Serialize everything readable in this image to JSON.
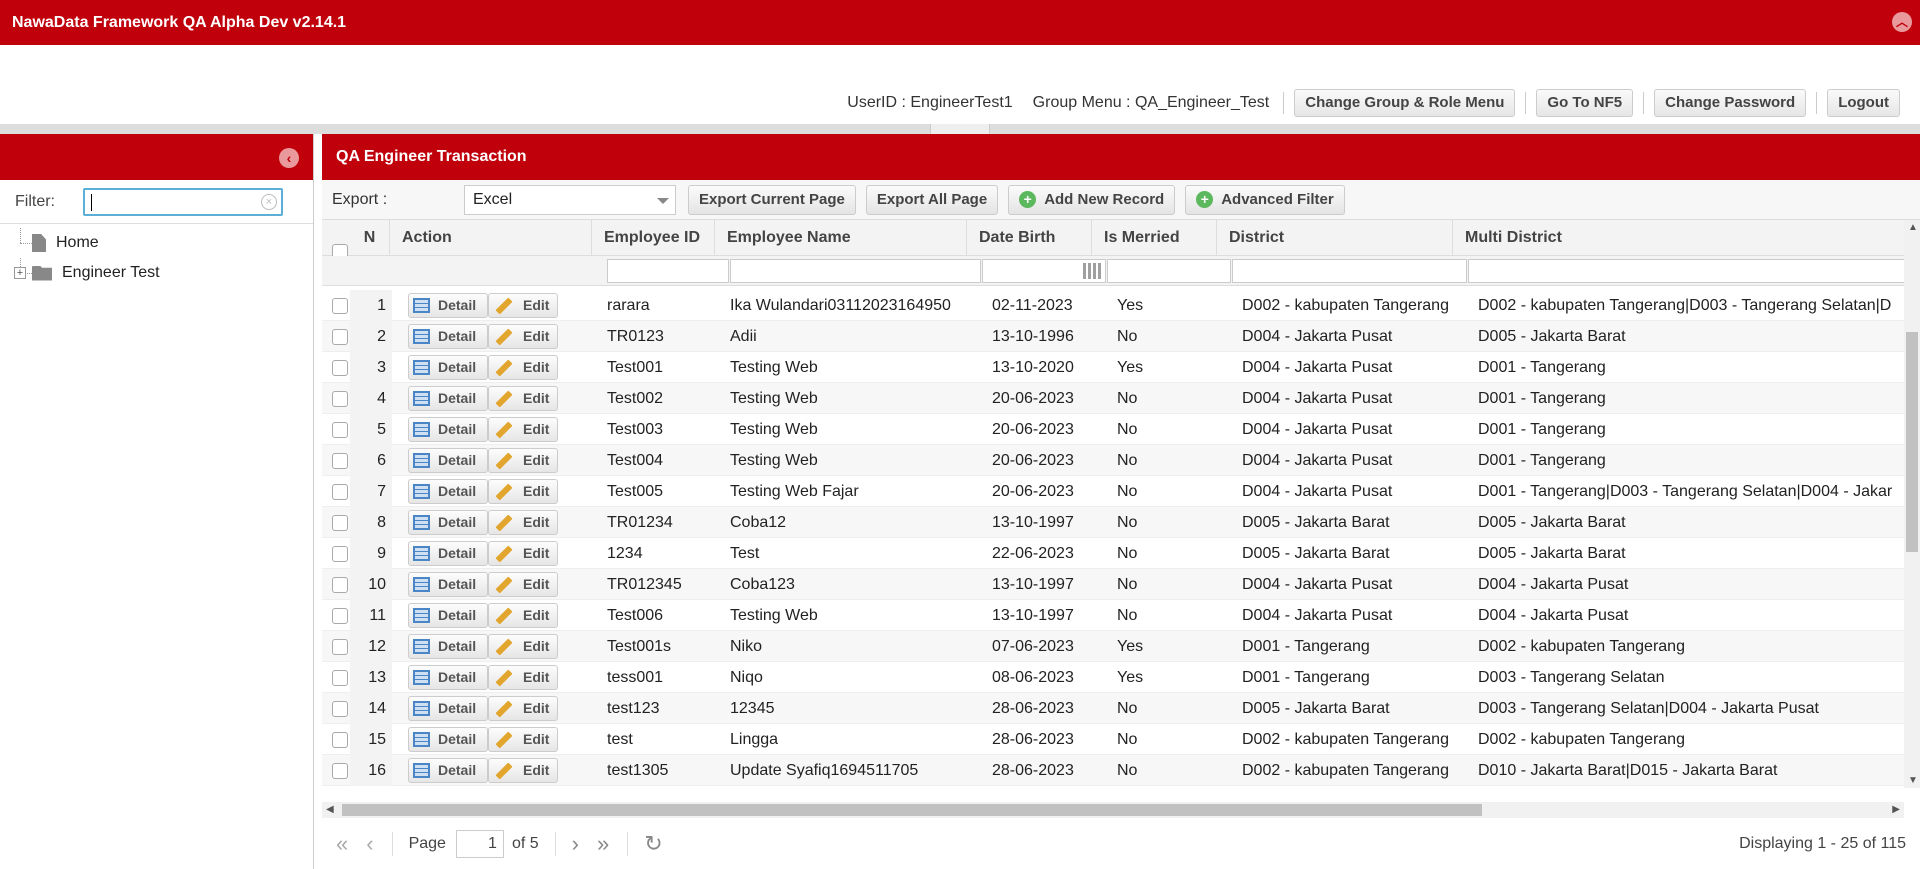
{
  "app": {
    "title": "NawaData Framework QA Alpha Dev v2.14.1"
  },
  "user": {
    "user_id": "UserID : EngineerTest1",
    "group_menu": "Group Menu : QA_Engineer_Test",
    "buttons": [
      "Change Group & Role Menu",
      "Go To NF5",
      "Change Password",
      "Logout"
    ]
  },
  "sidebar": {
    "filter_label": "Filter:",
    "filter_value": "",
    "tree": [
      {
        "label": "Home",
        "type": "file"
      },
      {
        "label": "Engineer Test",
        "type": "folder"
      }
    ]
  },
  "main": {
    "title": "QA Engineer Transaction",
    "export_label": "Export :",
    "export_selected": "Excel",
    "toolbar_buttons": [
      "Export Current Page",
      "Export All Page"
    ],
    "add_new_label": "Add New Record",
    "advanced_filter_label": "Advanced Filter"
  },
  "table": {
    "columns": [
      "N",
      "Action",
      "Employee ID",
      "Employee Name",
      "Date Birth",
      "Is Merried",
      "District",
      "Multi District"
    ],
    "detail_label": "Detail",
    "edit_label": "Edit",
    "rows": [
      [
        "1",
        "rarara",
        "Ika Wulandari03112023164950",
        "02-11-2023",
        "Yes",
        "D002 - kabupaten Tangerang",
        "D002 - kabupaten Tangerang|D003 - Tangerang Selatan|D"
      ],
      [
        "2",
        "TR0123",
        "Adii",
        "13-10-1996",
        "No",
        "D004 - Jakarta Pusat",
        "D005 - Jakarta Barat"
      ],
      [
        "3",
        "Test001",
        "Testing Web",
        "13-10-2020",
        "Yes",
        "D004 - Jakarta Pusat",
        "D001 - Tangerang"
      ],
      [
        "4",
        "Test002",
        "Testing Web",
        "20-06-2023",
        "No",
        "D004 - Jakarta Pusat",
        "D001 - Tangerang"
      ],
      [
        "5",
        "Test003",
        "Testing Web",
        "20-06-2023",
        "No",
        "D004 - Jakarta Pusat",
        "D001 - Tangerang"
      ],
      [
        "6",
        "Test004",
        "Testing Web",
        "20-06-2023",
        "No",
        "D004 - Jakarta Pusat",
        "D001 - Tangerang"
      ],
      [
        "7",
        "Test005",
        "Testing Web Fajar",
        "20-06-2023",
        "No",
        "D004 - Jakarta Pusat",
        "D001 - Tangerang|D003 - Tangerang Selatan|D004 - Jakar"
      ],
      [
        "8",
        "TR01234",
        "Coba12",
        "13-10-1997",
        "No",
        "D005 - Jakarta Barat",
        "D005 - Jakarta Barat"
      ],
      [
        "9",
        "1234",
        "Test",
        "22-06-2023",
        "No",
        "D005 - Jakarta Barat",
        "D005 - Jakarta Barat"
      ],
      [
        "10",
        "TR012345",
        "Coba123",
        "13-10-1997",
        "No",
        "D004 - Jakarta Pusat",
        "D004 - Jakarta Pusat"
      ],
      [
        "11",
        "Test006",
        "Testing Web",
        "13-10-1997",
        "No",
        "D004 - Jakarta Pusat",
        "D004 - Jakarta Pusat"
      ],
      [
        "12",
        "Test001s",
        "Niko",
        "07-06-2023",
        "Yes",
        "D001 - Tangerang",
        "D002 - kabupaten Tangerang"
      ],
      [
        "13",
        "tess001",
        "Niqo",
        "08-06-2023",
        "Yes",
        "D001 - Tangerang",
        "D003 - Tangerang Selatan"
      ],
      [
        "14",
        "test123",
        "12345",
        "28-06-2023",
        "No",
        "D005 - Jakarta Barat",
        "D003 - Tangerang Selatan|D004 - Jakarta Pusat"
      ],
      [
        "15",
        "test",
        "Lingga",
        "28-06-2023",
        "No",
        "D002 - kabupaten Tangerang",
        "D002 - kabupaten Tangerang"
      ],
      [
        "16",
        "test1305",
        "Update Syafiq1694511705",
        "28-06-2023",
        "No",
        "D002 - kabupaten Tangerang",
        "D010 - Jakarta Barat|D015 - Jakarta Barat"
      ]
    ]
  },
  "pager": {
    "page_label": "Page",
    "page_value": "1",
    "of_label": "of 5",
    "display_text": "Displaying 1 - 25 of 115"
  },
  "colors": {
    "brand": "#c0000b",
    "accent": "#5cb85c"
  }
}
